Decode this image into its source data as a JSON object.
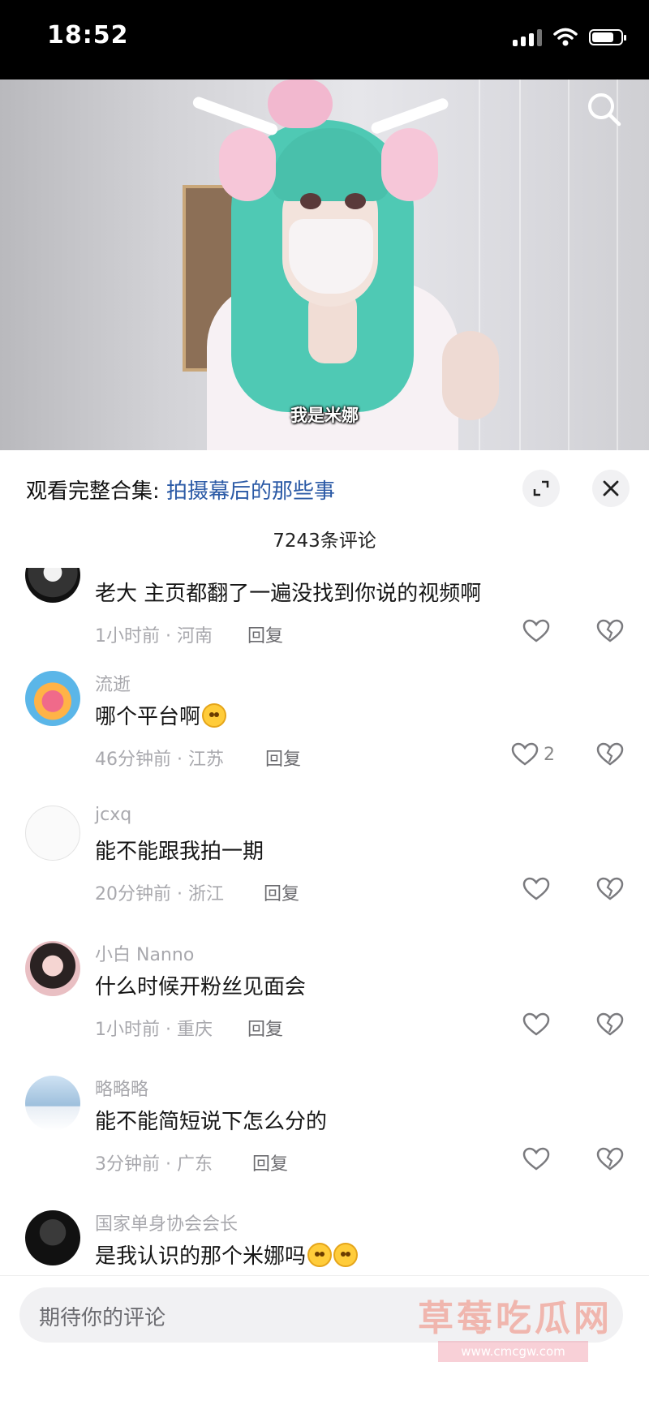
{
  "status": {
    "time": "18:52"
  },
  "video": {
    "subtitle": "我是米娜"
  },
  "sheet": {
    "collection_prefix": "观看完整合集: ",
    "collection_title": "拍摄幕后的那些事",
    "comment_count": "7243条评论"
  },
  "comments": [
    {
      "name": "",
      "text": "老大 主页都翻了一遍没找到你说的视频啊",
      "meta": "1小时前 · 河南",
      "reply": "回复",
      "likes": ""
    },
    {
      "name": "流逝",
      "text": "哪个平台啊",
      "meta": "46分钟前 · 江苏",
      "reply": "回复",
      "likes": "2"
    },
    {
      "name": "jcxq",
      "text": "能不能跟我拍一期",
      "meta": "20分钟前 · 浙江",
      "reply": "回复",
      "likes": ""
    },
    {
      "name": "小白 Nanno",
      "text": "什么时候开粉丝见面会",
      "meta": "1小时前 · 重庆",
      "reply": "回复",
      "likes": ""
    },
    {
      "name": "略略略",
      "text": "能不能简短说下怎么分的",
      "meta": "3分钟前 · 广东",
      "reply": "回复",
      "likes": ""
    },
    {
      "name": "国家单身协会会长",
      "text": "是我认识的那个米娜吗",
      "meta": "",
      "reply": "",
      "likes": ""
    }
  ],
  "input": {
    "placeholder": "期待你的评论"
  },
  "watermark": {
    "text": "草莓吃瓜网",
    "url": "www.cmcgw.com"
  },
  "colors": {
    "link": "#2b5aa6",
    "meta": "#a8a8ad",
    "accent_emoji": "#ffcc3a"
  },
  "icons": [
    "signal-icon",
    "wifi-icon",
    "battery-icon",
    "search-icon",
    "expand-icon",
    "close-icon",
    "heart-icon",
    "broken-heart-icon"
  ]
}
